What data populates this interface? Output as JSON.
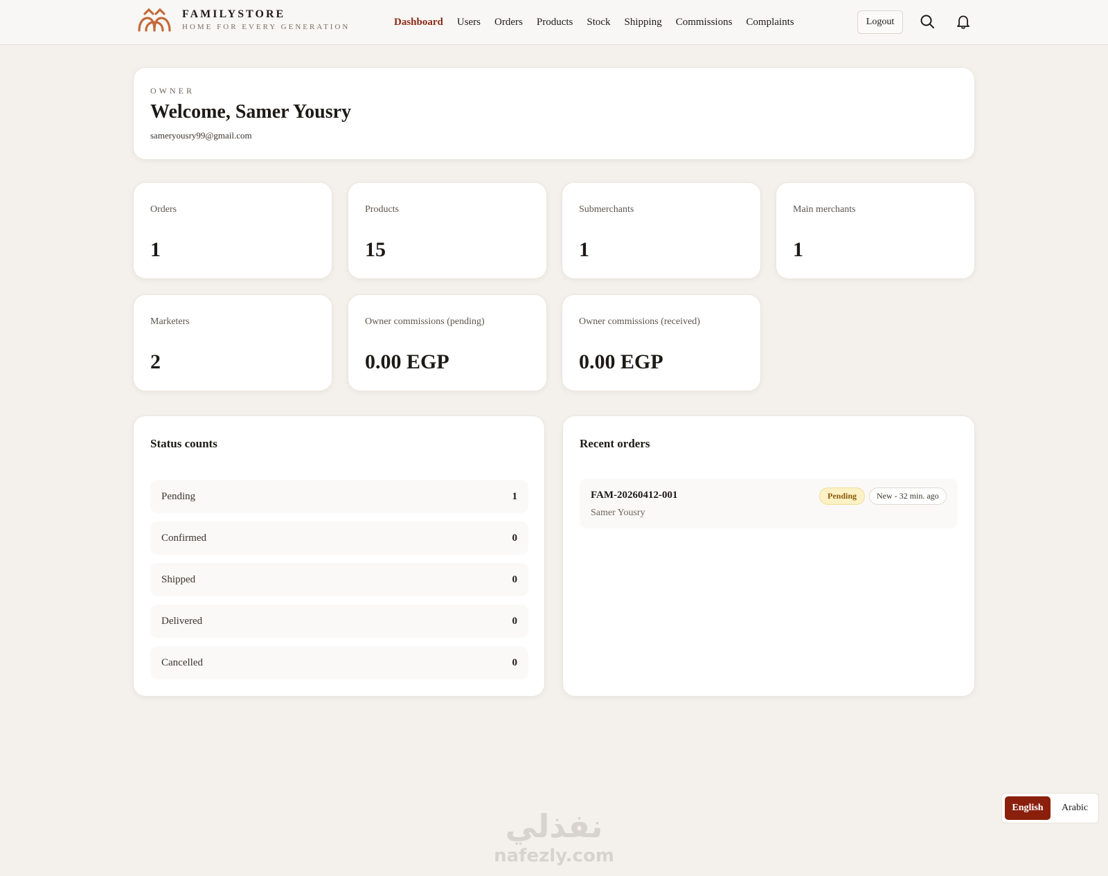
{
  "brand": {
    "name": "FAMILYSTORE",
    "tagline": "HOME FOR EVERY GENERATION",
    "accent_color": "#8a2a14",
    "logo_color": "#c46a3a"
  },
  "nav": {
    "items": [
      {
        "label": "Dashboard",
        "active": true
      },
      {
        "label": "Users"
      },
      {
        "label": "Orders"
      },
      {
        "label": "Products"
      },
      {
        "label": "Stock"
      },
      {
        "label": "Shipping"
      },
      {
        "label": "Commissions"
      },
      {
        "label": "Complaints"
      }
    ],
    "logout_label": "Logout",
    "search_icon": "search-icon",
    "notification_icon": "bell-icon"
  },
  "welcome": {
    "role": "OWNER",
    "title": "Welcome, Samer Yousry",
    "email": "sameryousry99@gmail.com"
  },
  "stats": [
    {
      "label": "Orders",
      "value": "1"
    },
    {
      "label": "Products",
      "value": "15"
    },
    {
      "label": "Submerchants",
      "value": "1"
    },
    {
      "label": "Main merchants",
      "value": "1"
    },
    {
      "label": "Marketers",
      "value": "2"
    },
    {
      "label": "Owner commissions (pending)",
      "value": "0.00 EGP"
    },
    {
      "label": "Owner commissions (received)",
      "value": "0.00 EGP"
    }
  ],
  "status_counts": {
    "title": "Status counts",
    "rows": [
      {
        "name": "Pending",
        "count": "1"
      },
      {
        "name": "Confirmed",
        "count": "0"
      },
      {
        "name": "Shipped",
        "count": "0"
      },
      {
        "name": "Delivered",
        "count": "0"
      },
      {
        "name": "Cancelled",
        "count": "0"
      }
    ]
  },
  "recent_orders": {
    "title": "Recent orders",
    "orders": [
      {
        "id": "FAM-20260412-001",
        "customer": "Samer Yousry",
        "status": "Pending",
        "age": "New - 32 min. ago",
        "status_color": "#fdf1c6"
      }
    ]
  },
  "language": {
    "english": "English",
    "arabic": "Arabic",
    "active_color": "#8a1f0c"
  },
  "watermark": {
    "arabic": "نفذلي",
    "latin": "nafezly.com"
  }
}
